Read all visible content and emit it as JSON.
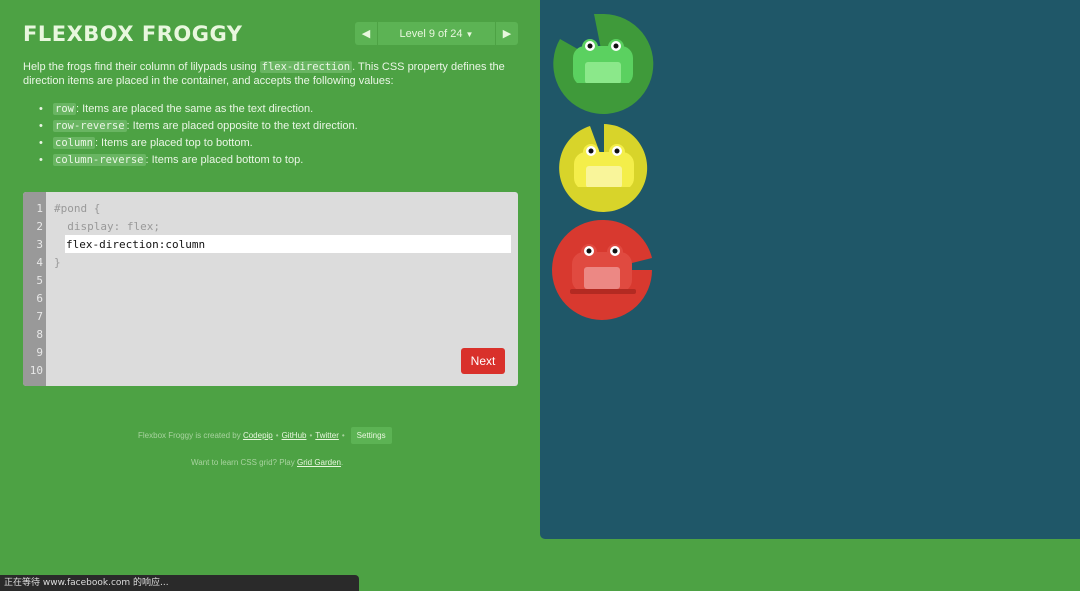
{
  "header": {
    "title": "FLEXBOX FROGGY",
    "level_label": "Level 9 of 24",
    "prev_icon": "triangle-left-icon",
    "next_icon": "triangle-right-icon"
  },
  "intro": {
    "text_before": "Help the frogs find their column of lilypads using ",
    "property": "flex-direction",
    "text_after": ". This CSS property defines the direction items are placed in the container, and accepts the following values:"
  },
  "values": [
    {
      "code": "row",
      "desc": ": Items are placed the same as the text direction."
    },
    {
      "code": "row-reverse",
      "desc": ": Items are placed opposite to the text direction."
    },
    {
      "code": "column",
      "desc": ": Items are placed top to bottom."
    },
    {
      "code": "column-reverse",
      "desc": ": Items are placed bottom to top."
    }
  ],
  "editor": {
    "line_numbers": [
      "1",
      "2",
      "3",
      "4",
      "5",
      "6",
      "7",
      "8",
      "9",
      "10"
    ],
    "line1": "#pond {",
    "line2": "  display: flex;",
    "input_value": "flex-direction:column",
    "line4": "}",
    "next_label": "Next"
  },
  "footer": {
    "created_by": "Flexbox Froggy is created by",
    "codepip": "Codepip",
    "bullet": "•",
    "github": "GitHub",
    "twitter": "Twitter",
    "settings": "Settings",
    "grid_text": "Want to learn CSS grid? Play",
    "grid_link": "Grid Garden",
    "grid_period": "."
  },
  "pond": {
    "frogs": [
      {
        "color": "green",
        "pad": "#3f9a3a",
        "body": "#5bd160",
        "belly": "#8be88a"
      },
      {
        "color": "yellow",
        "pad": "#d8d42a",
        "body": "#f4ee4a",
        "belly": "#f9f59a"
      },
      {
        "color": "red",
        "pad": "#d8392f",
        "body": "#e04a40",
        "belly": "#ec8884"
      }
    ]
  },
  "status_bar": {
    "text": "正在等待 www.facebook.com 的响应..."
  }
}
